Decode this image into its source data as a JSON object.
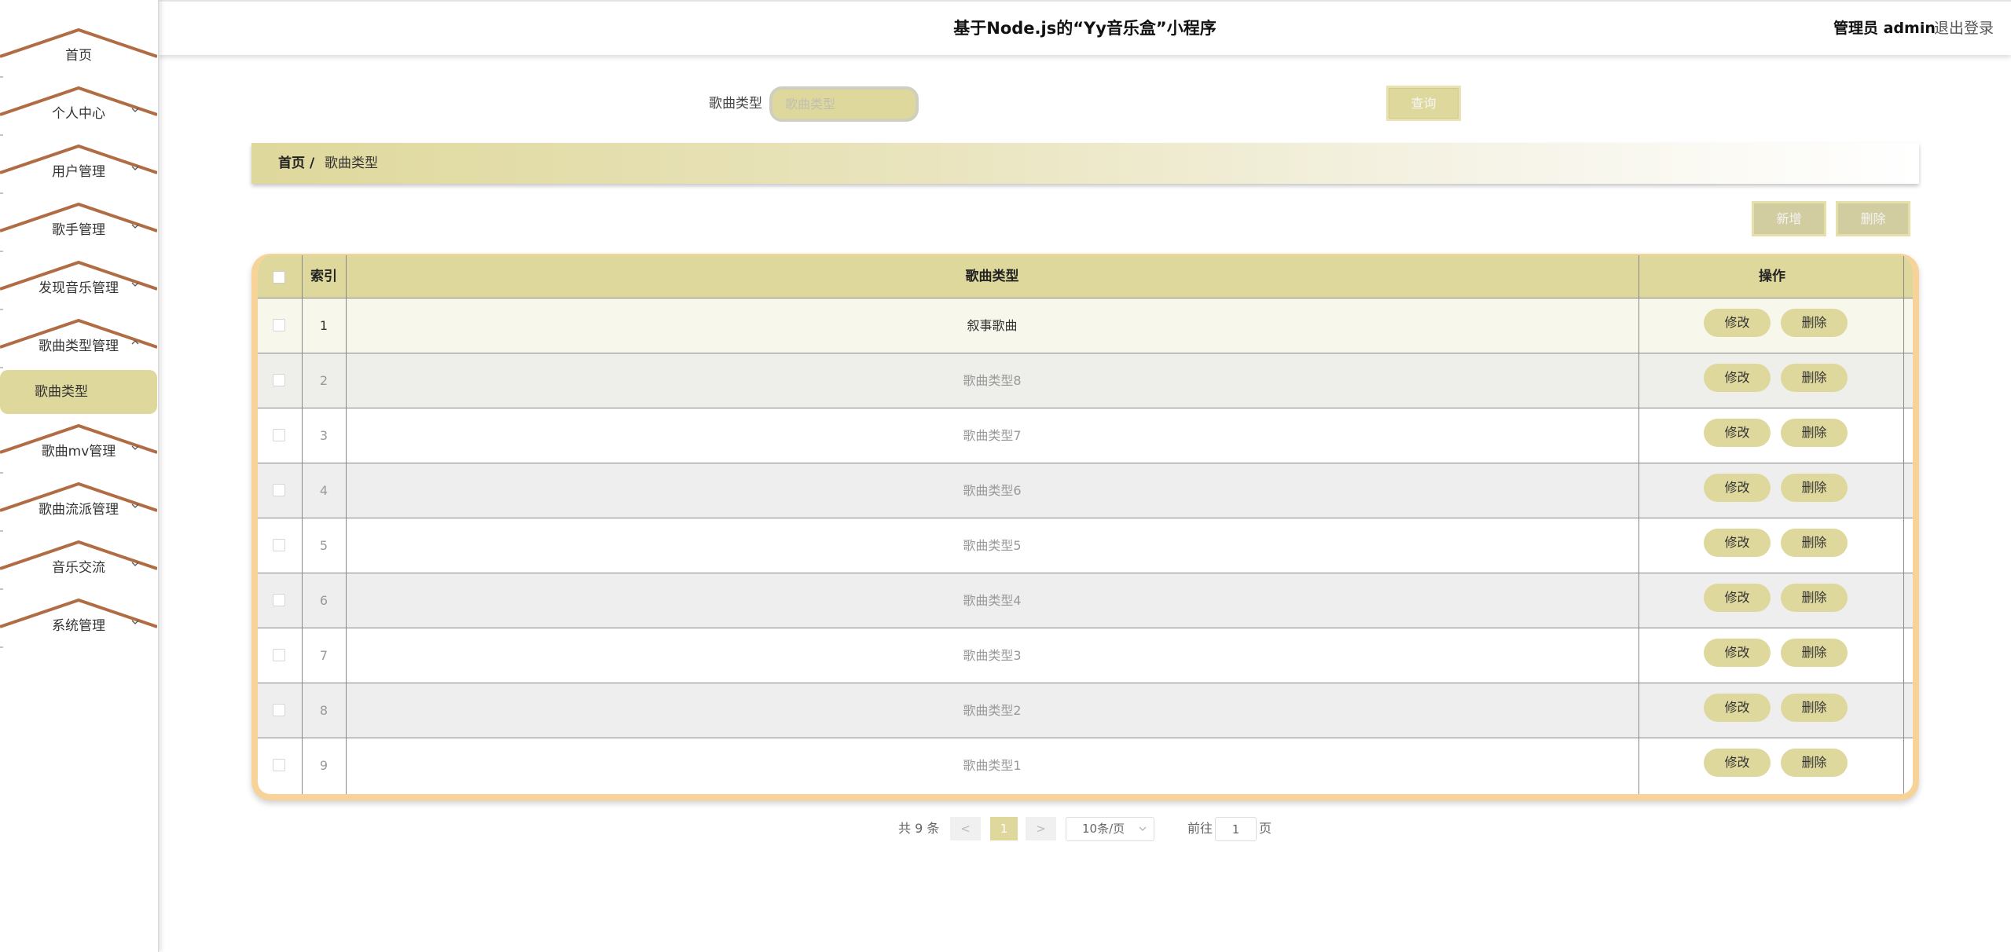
{
  "header": {
    "title": "基于Node.js的“Yy音乐盒”小程序",
    "user": "管理员 admin",
    "logout": "退出登录"
  },
  "sidebar": {
    "items": [
      {
        "label": "首页"
      },
      {
        "label": "个人中心"
      },
      {
        "label": "用户管理"
      },
      {
        "label": "歌手管理"
      },
      {
        "label": "发现音乐管理"
      },
      {
        "label": "歌曲类型管理"
      },
      {
        "label": "歌曲mv管理"
      },
      {
        "label": "歌曲流派管理"
      },
      {
        "label": "音乐交流"
      },
      {
        "label": "系统管理"
      }
    ],
    "active_sub": "歌曲类型"
  },
  "search": {
    "label": "歌曲类型",
    "placeholder": "歌曲类型",
    "button": "查询"
  },
  "breadcrumb": {
    "home": "首页",
    "separator": "/",
    "current": "歌曲类型"
  },
  "actions": {
    "add": "新增",
    "delete": "删除"
  },
  "table": {
    "headers": {
      "index": "索引",
      "type": "歌曲类型",
      "ops": "操作"
    },
    "rows": [
      {
        "index": "1",
        "type": "叙事歌曲",
        "edit": "修改",
        "delete": "删除"
      },
      {
        "index": "2",
        "type": "歌曲类型8",
        "edit": "修改",
        "delete": "删除"
      },
      {
        "index": "3",
        "type": "歌曲类型7",
        "edit": "修改",
        "delete": "删除"
      },
      {
        "index": "4",
        "type": "歌曲类型6",
        "edit": "修改",
        "delete": "删除"
      },
      {
        "index": "5",
        "type": "歌曲类型5",
        "edit": "修改",
        "delete": "删除"
      },
      {
        "index": "6",
        "type": "歌曲类型4",
        "edit": "修改",
        "delete": "删除"
      },
      {
        "index": "7",
        "type": "歌曲类型3",
        "edit": "修改",
        "delete": "删除"
      },
      {
        "index": "8",
        "type": "歌曲类型2",
        "edit": "修改",
        "delete": "删除"
      },
      {
        "index": "9",
        "type": "歌曲类型1",
        "edit": "修改",
        "delete": "删除"
      }
    ]
  },
  "pagination": {
    "total": "共 9 条",
    "prev": "<",
    "page": "1",
    "next": ">",
    "page_size": "10条/页",
    "goto": "前往",
    "goto_value": "1",
    "page_unit": "页"
  },
  "colors": {
    "accent": "#dfd89c",
    "roof": "#b06c42",
    "table_border": "#f7d39a"
  }
}
